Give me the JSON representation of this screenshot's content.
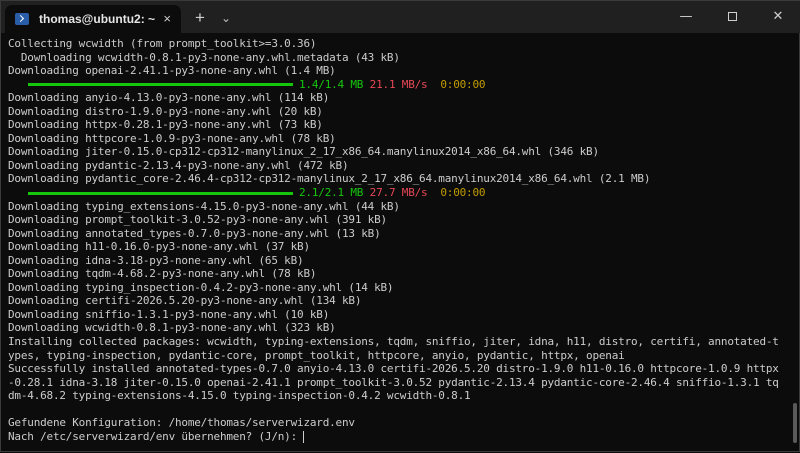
{
  "tab": {
    "title": "thomas@ubuntu2: ~",
    "icon": "terminal-icon",
    "close": "×"
  },
  "titlebar": {
    "new_tab": "+",
    "dropdown": "⌄",
    "minimize": "—",
    "maximize": "□",
    "close": "✕"
  },
  "colors": {
    "progress_green": "#16c60c",
    "speed_red": "#e74856",
    "eta_yellow": "#c19c00",
    "text": "#cccccc",
    "bg": "#0c0c0c"
  },
  "lines": [
    "Collecting wcwidth (from prompt_toolkit>=3.0.36)",
    "  Downloading wcwidth-0.8.1-py3-none-any.whl.metadata (43 kB)",
    "Downloading openai-2.41.1-py3-none-any.whl (1.4 MB)"
  ],
  "progress1": {
    "size": "1.4/1.4 MB",
    "speed": "21.1 MB/s",
    "eta": "0:00:00",
    "fraction": 1.0
  },
  "lines2": [
    "Downloading anyio-4.13.0-py3-none-any.whl (114 kB)",
    "Downloading distro-1.9.0-py3-none-any.whl (20 kB)",
    "Downloading httpx-0.28.1-py3-none-any.whl (73 kB)",
    "Downloading httpcore-1.0.9-py3-none-any.whl (78 kB)",
    "Downloading jiter-0.15.0-cp312-cp312-manylinux_2_17_x86_64.manylinux2014_x86_64.whl (346 kB)",
    "Downloading pydantic-2.13.4-py3-none-any.whl (472 kB)",
    "Downloading pydantic_core-2.46.4-cp312-cp312-manylinux_2_17_x86_64.manylinux2014_x86_64.whl (2.1 MB)"
  ],
  "progress2": {
    "size": "2.1/2.1 MB",
    "speed": "27.7 MB/s",
    "eta": "0:00:00",
    "fraction": 1.0
  },
  "lines3": [
    "Downloading typing_extensions-4.15.0-py3-none-any.whl (44 kB)",
    "Downloading prompt_toolkit-3.0.52-py3-none-any.whl (391 kB)",
    "Downloading annotated_types-0.7.0-py3-none-any.whl (13 kB)",
    "Downloading h11-0.16.0-py3-none-any.whl (37 kB)",
    "Downloading idna-3.18-py3-none-any.whl (65 kB)",
    "Downloading tqdm-4.68.2-py3-none-any.whl (78 kB)",
    "Downloading typing_inspection-0.4.2-py3-none-any.whl (14 kB)",
    "Downloading certifi-2026.5.20-py3-none-any.whl (134 kB)",
    "Downloading sniffio-1.3.1-py3-none-any.whl (10 kB)",
    "Downloading wcwidth-0.8.1-py3-none-any.whl (323 kB)",
    "Installing collected packages: wcwidth, typing-extensions, tqdm, sniffio, jiter, idna, h11, distro, certifi, annotated-t",
    "ypes, typing-inspection, pydantic-core, prompt_toolkit, httpcore, anyio, pydantic, httpx, openai",
    "Successfully installed annotated-types-0.7.0 anyio-4.13.0 certifi-2026.5.20 distro-1.9.0 h11-0.16.0 httpcore-1.0.9 httpx",
    "-0.28.1 idna-3.18 jiter-0.15.0 openai-2.41.1 prompt_toolkit-3.0.52 pydantic-2.13.4 pydantic-core-2.46.4 sniffio-1.3.1 tq",
    "dm-4.68.2 typing-extensions-4.15.0 typing-inspection-0.4.2 wcwidth-0.8.1",
    "",
    "Gefundene Konfiguration: /home/thomas/serverwizard.env"
  ],
  "prompt": "Nach /etc/serverwizard/env übernehmen? (J/n): "
}
